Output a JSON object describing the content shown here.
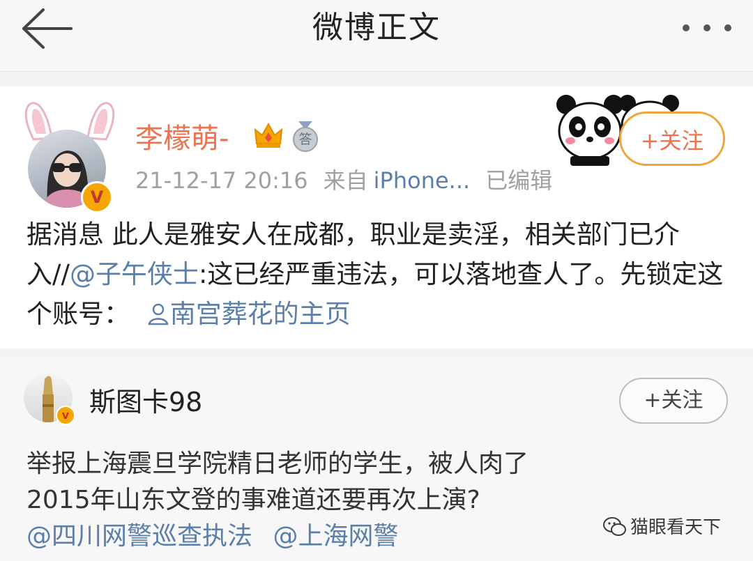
{
  "header": {
    "title": "微博正文",
    "back_icon": "arrow-left-icon",
    "more_icon": "more-dots-icon"
  },
  "post": {
    "author": "李檬萌-",
    "badge_v": "V",
    "medal_char": "答",
    "follow_label": "+关注",
    "time": "21-12-17 20:16",
    "source_prefix": "来自",
    "source": "iPhone...",
    "edited": "已编辑",
    "text_part1": "据消息 此人是雅安人在成都，职业是卖淫，相关部门已介入//",
    "mention": "@子午侠士",
    "text_part2": ":这已经严重违法，可以落地查人了。先锁定这个账号：",
    "profile_link": "南宫葬花的主页"
  },
  "repost": {
    "author": "斯图卡98",
    "badge_v": "v",
    "follow_label": "+关注",
    "line1": "举报上海震旦学院精日老师的学生，被人肉了",
    "line2": "2015年山东文登的事难道还要再次上演?",
    "mention1": "@四川网警巡查执法",
    "mention2": "@上海网警"
  },
  "watermark": {
    "text": "猫眼看天下",
    "icon": "wechat-icon"
  },
  "colors": {
    "accent": "#eb7350",
    "link": "#5b7fa8",
    "follow_border": "#f0a53c"
  }
}
